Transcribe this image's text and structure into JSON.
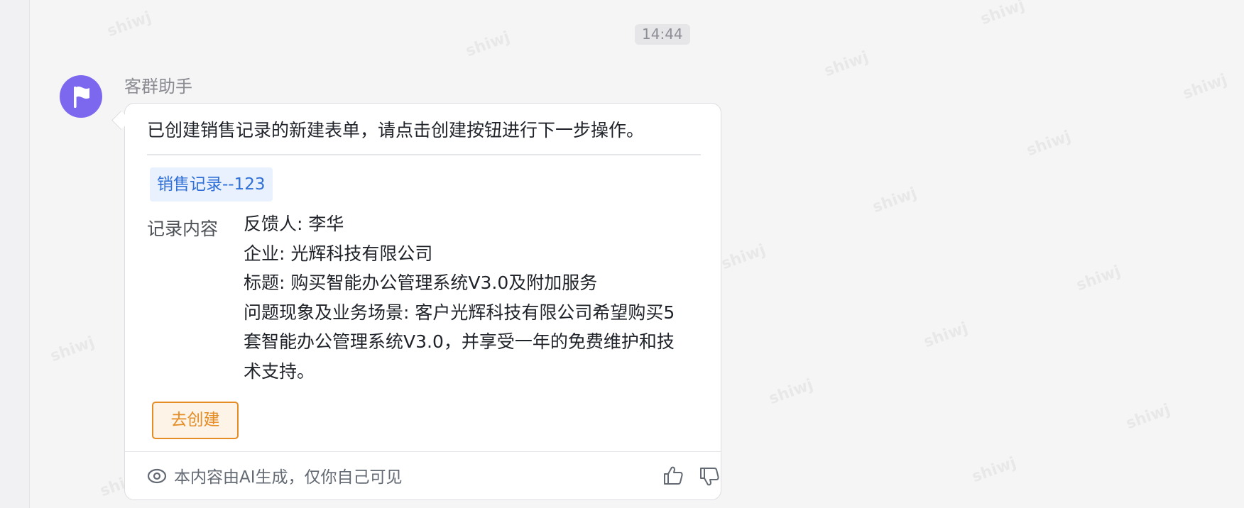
{
  "timestamp": "14:44",
  "watermark_text": "shiwj",
  "message": {
    "sender": "客群助手",
    "avatar_icon": "flag-icon",
    "avatar_color": "#7b68ee",
    "intro": "已创建销售记录的新建表单，请点击创建按钮进行下一步操作。",
    "tag": "销售记录--123",
    "record": {
      "label": "记录内容",
      "lines": [
        "反馈人: 李华",
        "企业: 光辉科技有限公司",
        "标题: 购买智能办公管理系统V3.0及附加服务",
        "问题现象及业务场景: 客户光辉科技有限公司希望购买5套智能办公管理系统V3.0，并享受一年的免费维护和技术支持。"
      ]
    },
    "create_button": "去创建",
    "footer": {
      "notice_icon": "eye-icon",
      "notice": "本内容由AI生成，仅你自己可见",
      "like_icon": "thumb-up-icon",
      "dislike_icon": "thumb-down-icon"
    }
  }
}
